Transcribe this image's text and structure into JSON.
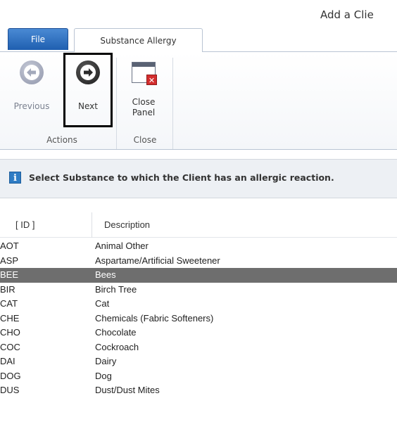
{
  "window": {
    "title": "Add a Clie"
  },
  "tabs": {
    "file": "File",
    "substance": "Substance Allergy"
  },
  "ribbon": {
    "actions": {
      "label": "Actions",
      "previous": "Previous",
      "next": "Next"
    },
    "close": {
      "label": "Close",
      "close_line1": "Close",
      "close_line2": "Panel"
    }
  },
  "info": {
    "message": "Select Substance to which the Client has an allergic reaction."
  },
  "table": {
    "headers": {
      "id": "[ ID ]",
      "description": "Description"
    },
    "rows": [
      {
        "id": "AOT",
        "description": "Animal Other"
      },
      {
        "id": "ASP",
        "description": "Aspartame/Artificial Sweetener"
      },
      {
        "id": "BEE",
        "description": "Bees"
      },
      {
        "id": "BIR",
        "description": "Birch Tree"
      },
      {
        "id": "CAT",
        "description": "Cat"
      },
      {
        "id": "CHE",
        "description": "Chemicals (Fabric Softeners)"
      },
      {
        "id": "CHO",
        "description": "Chocolate"
      },
      {
        "id": "COC",
        "description": "Cockroach"
      },
      {
        "id": "DAI",
        "description": "Dairy"
      },
      {
        "id": "DOG",
        "description": "Dog"
      },
      {
        "id": "DUS",
        "description": "Dust/Dust Mites"
      }
    ],
    "selected_id": "BEE"
  }
}
